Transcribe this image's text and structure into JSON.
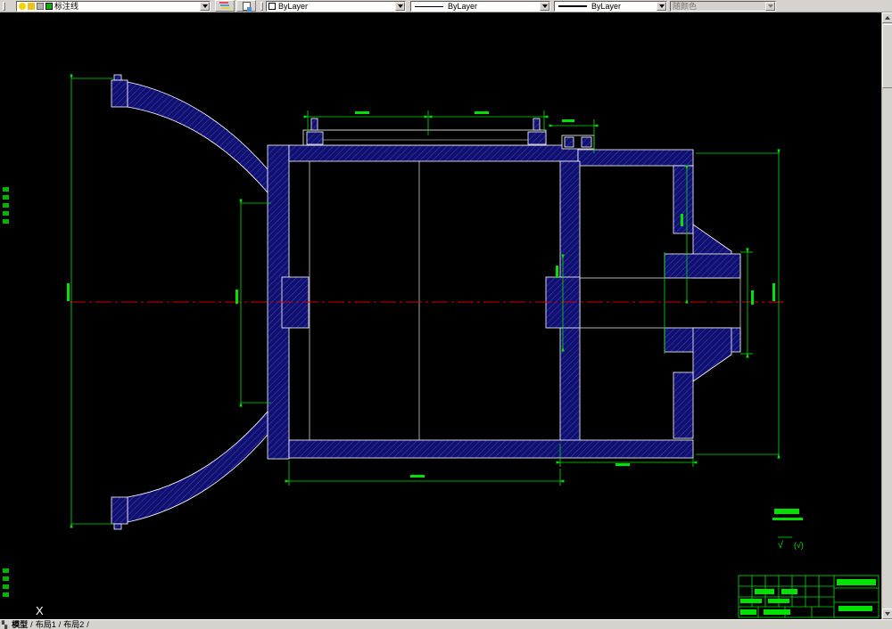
{
  "toolbar": {
    "layer_combo": {
      "value": "标注线"
    },
    "color_combo": {
      "value": "ByLayer"
    },
    "linetype_combo": {
      "value": "ByLayer"
    },
    "lineweight_combo": {
      "value": "ByLayer"
    },
    "plotstyle_combo": {
      "value": "随颜色"
    }
  },
  "tabs": {
    "model": "模型",
    "layout1": "布局1",
    "layout2": "布局2",
    "separator": "/"
  },
  "drawing": {
    "ucs_x_label": "X",
    "surface_finish": {
      "primary": "√",
      "secondary": "(√)"
    }
  },
  "colors": {
    "chrome": "#d6d3ce",
    "canvas_bg": "#000000",
    "solid_fill": "#10106e",
    "hatch_line": "#3a3ab8",
    "outline": "#ffffff",
    "dimension": "#00e100",
    "centerline": "#d40000"
  }
}
